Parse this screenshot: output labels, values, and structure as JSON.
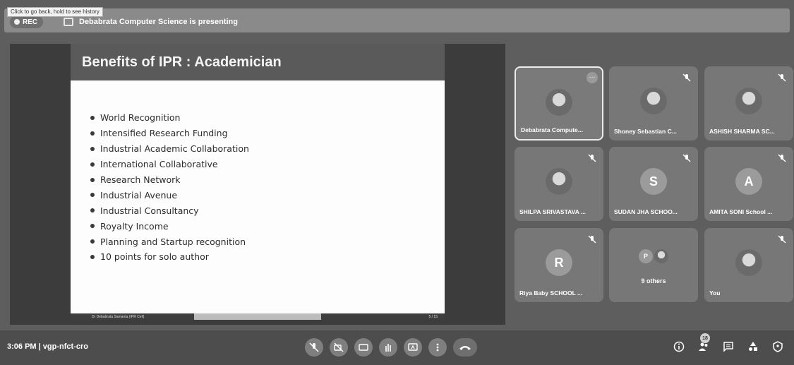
{
  "top": {
    "tooltip": "Click to go back, hold to see history",
    "rec_label": "REC",
    "presenting_text": "Debabrata Computer Science is presenting"
  },
  "slide": {
    "title": "Benefits of IPR : Academician",
    "bullets": [
      "World Recognition",
      "Intensified Research Funding",
      "Industrial Academic Collaboration",
      "International Collaborative",
      "Research Network",
      "Industrial Avenue",
      "Industrial Consultancy",
      "Royalty Income",
      "Planning and Startup recognition",
      "10 points for solo author"
    ],
    "footer_left": "Dr Debabrata Samanta (IPR Cell)",
    "footer_right": "5 / 15"
  },
  "participants": [
    {
      "name": "Debabrata Compute...",
      "type": "photo",
      "active": true
    },
    {
      "name": "Shoney Sebastian C...",
      "type": "photo",
      "muted": true
    },
    {
      "name": "ASHISH SHARMA SC...",
      "type": "photo",
      "muted": true
    },
    {
      "name": "SHILPA SRIVASTAVA ...",
      "type": "photo",
      "muted": true
    },
    {
      "name": "SUDAN JHA SCHOO...",
      "type": "letter",
      "letter": "S",
      "muted": true
    },
    {
      "name": "AMITA SONI School ...",
      "type": "letter",
      "letter": "A",
      "muted": true
    },
    {
      "name": "Riya Baby SCHOOL ...",
      "type": "letter",
      "letter": "R",
      "muted": true
    },
    {
      "name": "",
      "type": "others",
      "letter": "P",
      "count_label": "9 others"
    },
    {
      "name": "You",
      "type": "photo",
      "muted": true
    }
  ],
  "bottom": {
    "time": "3:06 PM",
    "separator": "|",
    "meeting_code": "vgp-nfct-cro",
    "controls": [
      "mic-off-icon",
      "camera-off-icon",
      "captions-icon",
      "raise-hand-icon",
      "present-icon",
      "more-options-icon",
      "end-call-icon"
    ],
    "people_count": "18"
  }
}
